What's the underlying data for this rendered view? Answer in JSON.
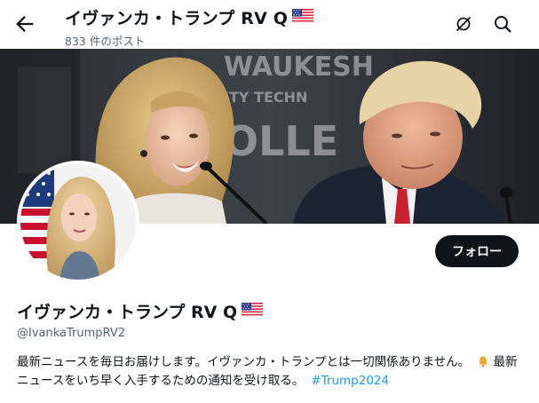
{
  "header": {
    "title": "イヴァンカ・トランプ RV Q",
    "post_count": "833 件のポスト"
  },
  "profile": {
    "name": "イヴァンカ・トランプ RV Q",
    "handle": "@IvankaTrumpRV2",
    "follow_label": "フォロー",
    "bio": {
      "part1": "最新ニュースを毎日お届けします。イヴァンカ・トランプとは一切関係ありません。",
      "part2": "最新ニュースをいち早く入手するための通知を受け取る。",
      "hashtag": "#Trump2024"
    }
  },
  "banner": {
    "sign_line1": "WAUKESH",
    "sign_line2": "ITY TECHN",
    "sign_line3": "OLLE"
  },
  "icons": {
    "back": "arrow-left-icon",
    "notify": "bell-slash-icon",
    "search": "search-icon",
    "flag": "us-flag-icon",
    "bell": "bell-emoji-icon"
  },
  "colors": {
    "text": "#0f1419",
    "muted": "#536471",
    "link": "#1d9bf0",
    "button": "#0f1419"
  }
}
